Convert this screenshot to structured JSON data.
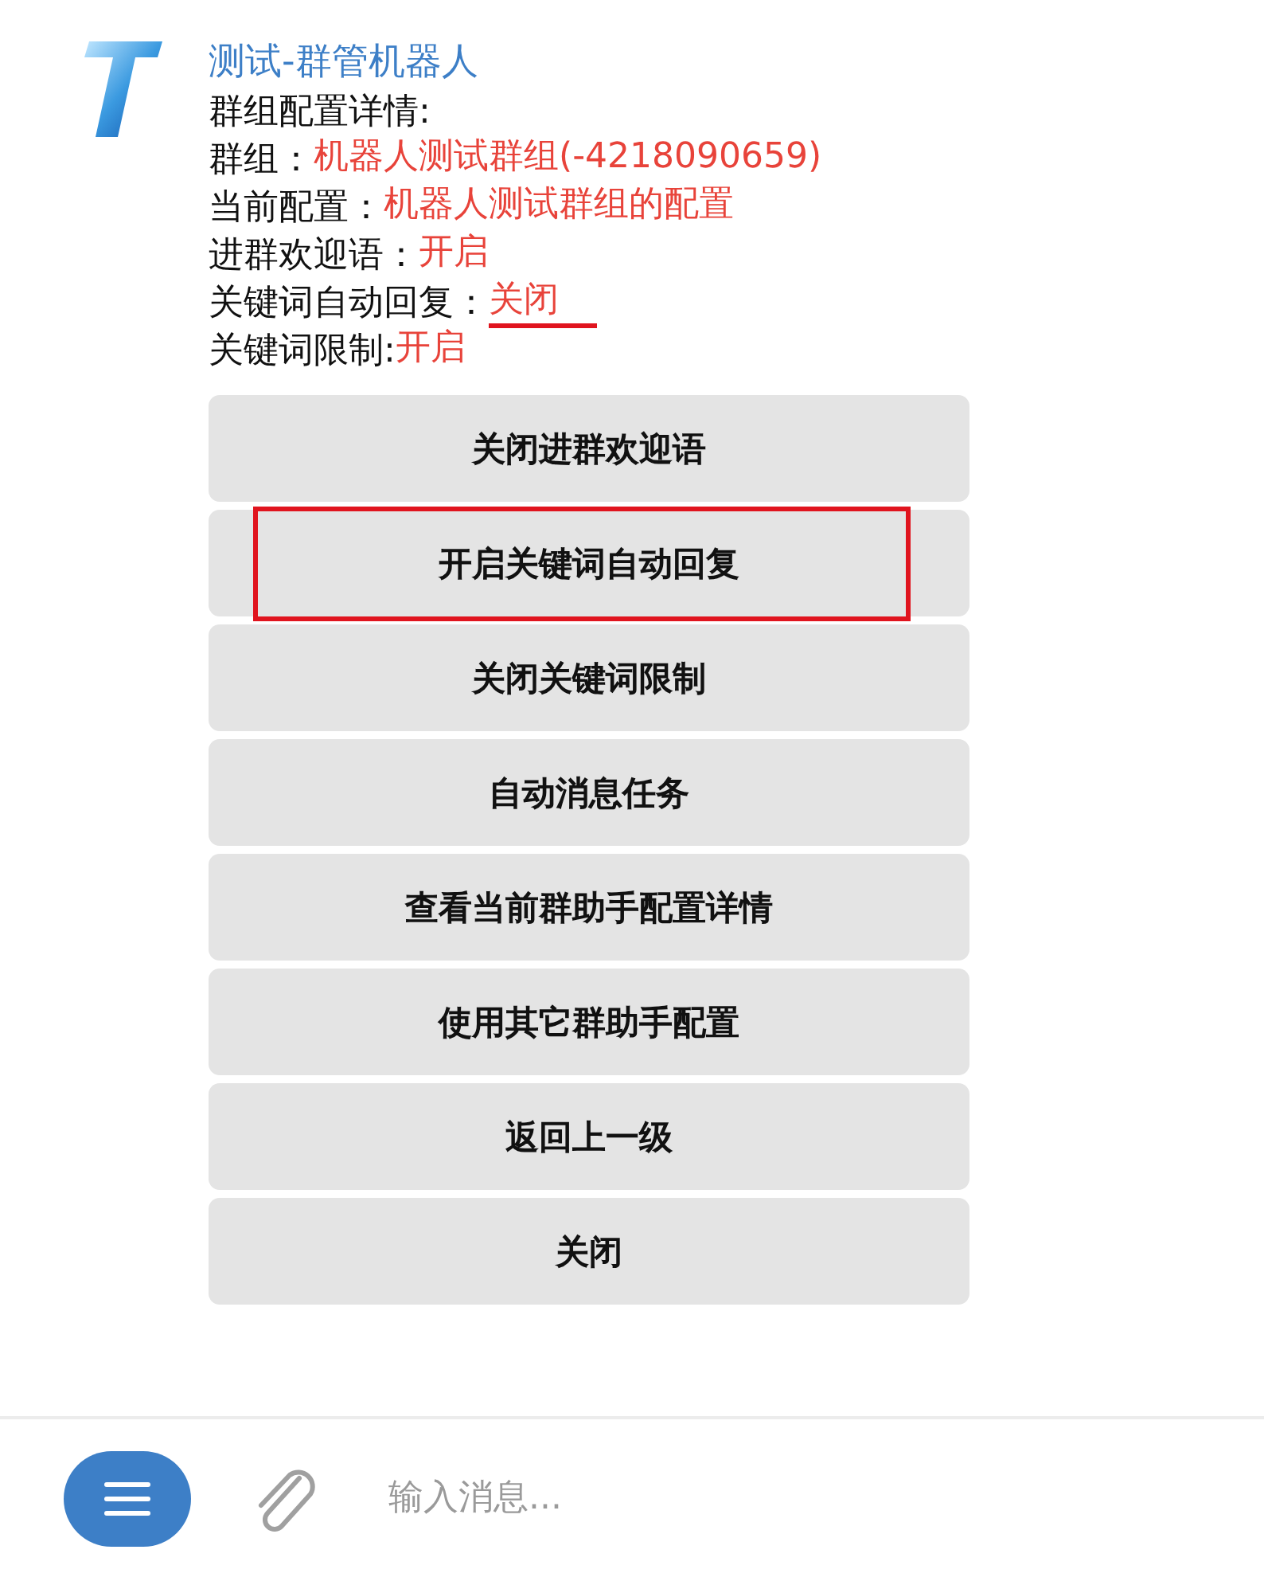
{
  "message": {
    "sender": "测试-群管机器人",
    "heading": "群组配置详情:",
    "lines": [
      {
        "label": "群组：",
        "value": "机器人测试群组(-4218090659)",
        "underlined": false
      },
      {
        "label": "当前配置：",
        "value": "机器人测试群组的配置",
        "underlined": false
      },
      {
        "label": "进群欢迎语：",
        "value": "开启",
        "underlined": false
      },
      {
        "label": "关键词自动回复：",
        "value": "关闭",
        "underlined": true
      },
      {
        "label": "关键词限制:",
        "value": "开启",
        "underlined": false
      }
    ]
  },
  "buttons": [
    {
      "label": "关闭进群欢迎语",
      "highlighted": false
    },
    {
      "label": "开启关键词自动回复",
      "highlighted": true
    },
    {
      "label": "关闭关键词限制",
      "highlighted": false
    },
    {
      "label": "自动消息任务",
      "highlighted": false
    },
    {
      "label": "查看当前群助手配置详情",
      "highlighted": false
    },
    {
      "label": "使用其它群助手配置",
      "highlighted": false
    },
    {
      "label": "返回上一级",
      "highlighted": false
    },
    {
      "label": "关闭",
      "highlighted": false
    }
  ],
  "composer": {
    "placeholder": "输入消息..."
  }
}
